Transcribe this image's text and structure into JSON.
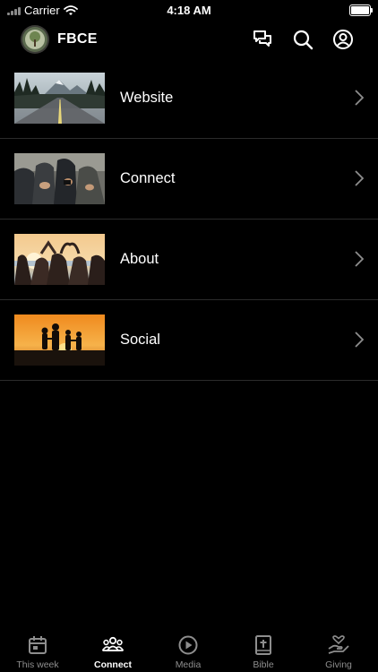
{
  "status_bar": {
    "carrier": "Carrier",
    "time": "4:18 AM"
  },
  "header": {
    "title": "FBCE",
    "icons": [
      "chat-icon",
      "search-icon",
      "profile-icon"
    ]
  },
  "menu": [
    {
      "label": "Website"
    },
    {
      "label": "Connect"
    },
    {
      "label": "About"
    },
    {
      "label": "Social"
    }
  ],
  "tabs": [
    {
      "label": "This week",
      "icon": "calendar-icon",
      "active": false
    },
    {
      "label": "Connect",
      "icon": "people-icon",
      "active": true
    },
    {
      "label": "Media",
      "icon": "play-icon",
      "active": false
    },
    {
      "label": "Bible",
      "icon": "bible-icon",
      "active": false
    },
    {
      "label": "Giving",
      "icon": "hand-heart-icon",
      "active": false
    }
  ],
  "colors": {
    "background": "#000000",
    "active": "#ffffff",
    "inactive": "#8e8e8e",
    "divider": "#2b2b2b"
  }
}
